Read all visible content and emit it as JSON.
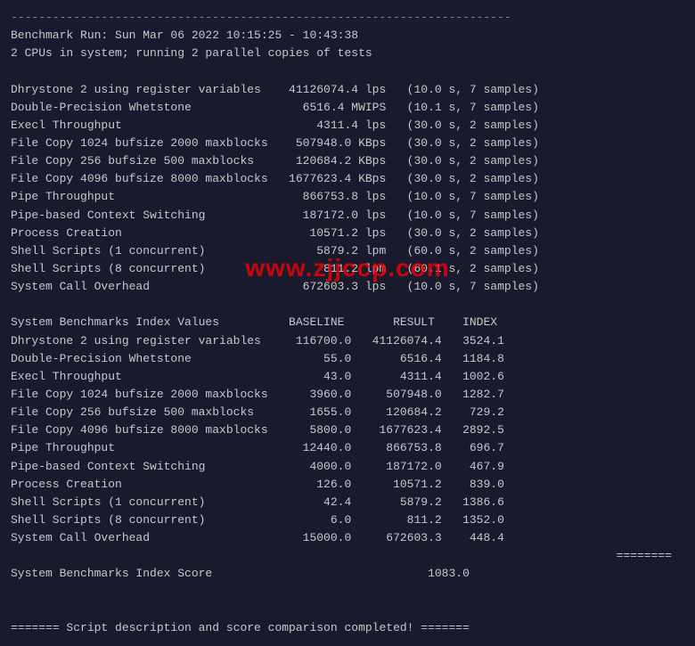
{
  "terminal": {
    "separator_line": "------------------------------------------------------------------------",
    "header": {
      "line1": "Benchmark Run: Sun Mar 06 2022 10:15:25 - 10:43:38",
      "line2": "2 CPUs in system; running 2 parallel copies of tests"
    },
    "blank1": "",
    "results": [
      {
        "label": "Dhrystone 2 using register variables",
        "value": "41126074.4 lps",
        "detail": "(10.0 s, 7 samples)"
      },
      {
        "label": "Double-Precision Whetstone",
        "value": "6516.4 MWIPS",
        "detail": "(10.1 s, 7 samples)"
      },
      {
        "label": "Execl Throughput",
        "value": "4311.4 lps",
        "detail": "(30.0 s, 2 samples)"
      },
      {
        "label": "File Copy 1024 bufsize 2000 maxblocks",
        "value": "507948.0 KBps",
        "detail": "(30.0 s, 2 samples)"
      },
      {
        "label": "File Copy 256 bufsize 500 maxblocks",
        "value": "120684.2 KBps",
        "detail": "(30.0 s, 2 samples)"
      },
      {
        "label": "File Copy 4096 bufsize 8000 maxblocks",
        "value": "1677623.4 KBps",
        "detail": "(30.0 s, 2 samples)"
      },
      {
        "label": "Pipe Throughput",
        "value": "866753.8 lps",
        "detail": "(10.0 s, 7 samples)"
      },
      {
        "label": "Pipe-based Context Switching",
        "value": "187172.0 lps",
        "detail": "(10.0 s, 7 samples)"
      },
      {
        "label": "Process Creation",
        "value": "10571.2 lps",
        "detail": "(30.0 s, 2 samples)"
      },
      {
        "label": "Shell Scripts (1 concurrent)",
        "value": "5879.2 lpm",
        "detail": "(60.0 s, 2 samples)"
      },
      {
        "label": "Shell Scripts (8 concurrent)",
        "value": "811.2 lpm",
        "detail": "(60.1 s, 2 samples)"
      },
      {
        "label": "System Call Overhead",
        "value": "672603.3 lps",
        "detail": "(10.0 s, 7 samples)"
      }
    ],
    "blank2": "",
    "index_header": "System Benchmarks Index Values          BASELINE       RESULT    INDEX",
    "index_rows": [
      {
        "label": "Dhrystone 2 using register variables",
        "baseline": "116700.0",
        "result": "41126074.4",
        "index": "3524.1"
      },
      {
        "label": "Double-Precision Whetstone",
        "baseline": "55.0",
        "result": "6516.4",
        "index": "1184.8"
      },
      {
        "label": "Execl Throughput",
        "baseline": "43.0",
        "result": "4311.4",
        "index": "1002.6"
      },
      {
        "label": "File Copy 1024 bufsize 2000 maxblocks",
        "baseline": "3960.0",
        "result": "507948.0",
        "index": "1282.7"
      },
      {
        "label": "File Copy 256 bufsize 500 maxblocks",
        "baseline": "1655.0",
        "result": "120684.2",
        "index": "729.2"
      },
      {
        "label": "File Copy 4096 bufsize 8000 maxblocks",
        "baseline": "5800.0",
        "result": "1677623.4",
        "index": "2892.5"
      },
      {
        "label": "Pipe Throughput",
        "baseline": "12440.0",
        "result": "866753.8",
        "index": "696.7"
      },
      {
        "label": "Pipe-based Context Switching",
        "baseline": "4000.0",
        "result": "187172.0",
        "index": "467.9"
      },
      {
        "label": "Process Creation",
        "baseline": "126.0",
        "result": "10571.2",
        "index": "839.0"
      },
      {
        "label": "Shell Scripts (1 concurrent)",
        "baseline": "42.4",
        "result": "5879.2",
        "index": "1386.6"
      },
      {
        "label": "Shell Scripts (8 concurrent)",
        "baseline": "6.0",
        "result": "811.2",
        "index": "1352.0"
      },
      {
        "label": "System Call Overhead",
        "baseline": "15000.0",
        "result": "672603.3",
        "index": "448.4"
      }
    ],
    "score_separator": "========",
    "score_label": "System Benchmarks Index Score",
    "score_value": "1083.0",
    "blank3": "",
    "blank4": "",
    "completion": "======= Script description and score comparison completed! ======="
  },
  "watermark": "www.zjjccp.com"
}
